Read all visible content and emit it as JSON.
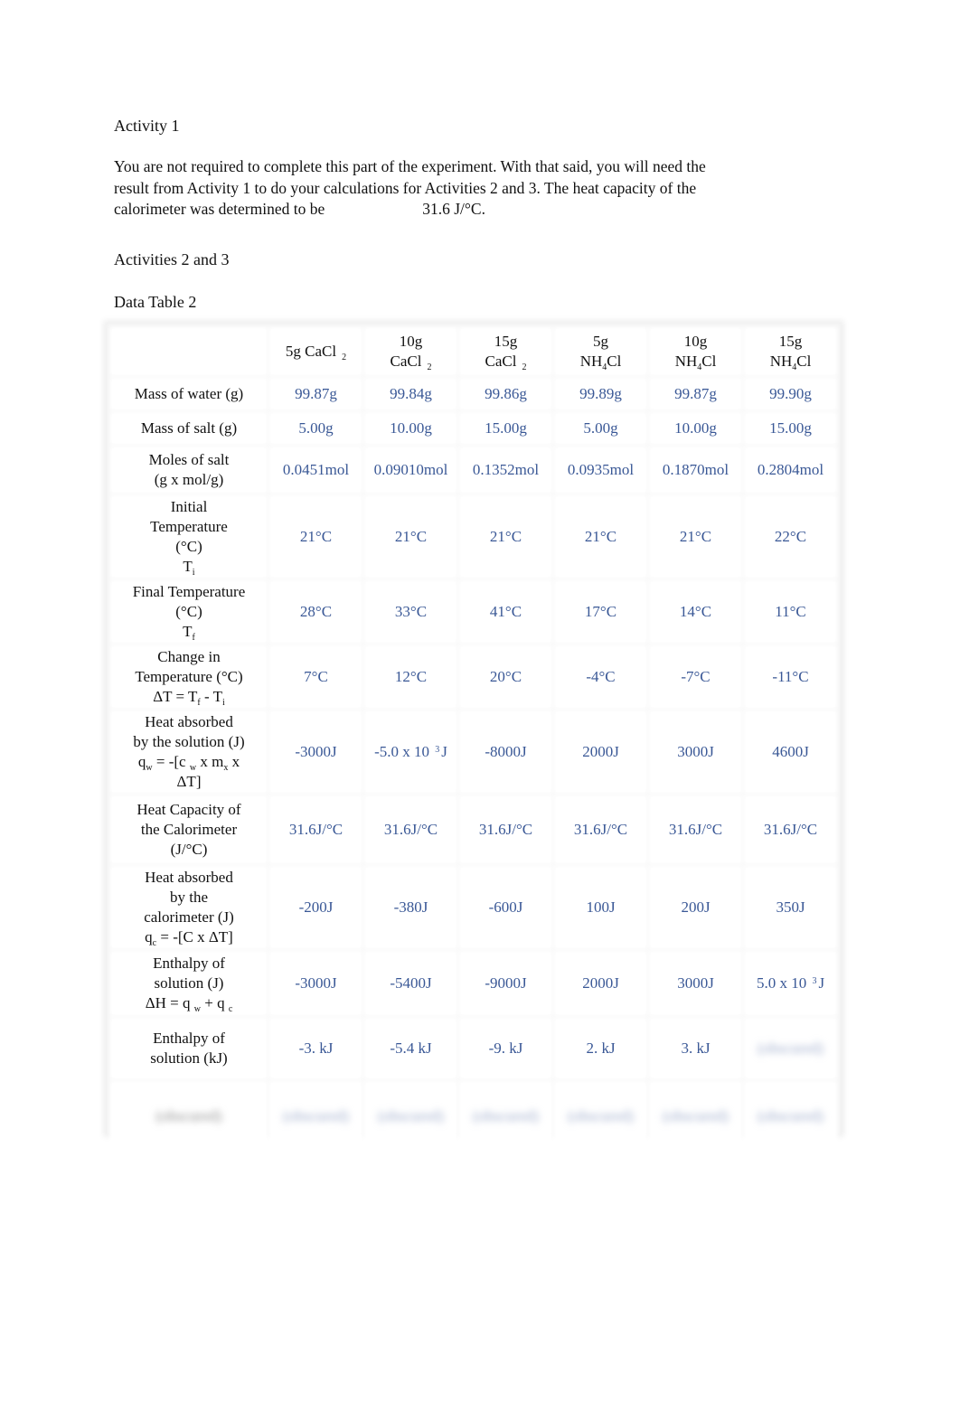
{
  "headings": {
    "activity1": "Activity 1",
    "activities23": "Activities 2 and 3",
    "data_table": "Data Table 2"
  },
  "intro": {
    "text": "You are not required to complete this part of the experiment. With that said, you will need the result from Activity 1 to do your calculations for Activities 2 and 3. The heat capacity of the calorimeter was determined to be",
    "value": "31.6 J/°C."
  },
  "table": {
    "columns": [
      {
        "amount": "5g",
        "formula": "CaCl",
        "sub": "2"
      },
      {
        "amount": "10g",
        "formula": "CaCl",
        "sub": "2"
      },
      {
        "amount": "15g",
        "formula": "CaCl",
        "sub": "2"
      },
      {
        "amount": "5g",
        "formula_pre": "NH",
        "sub": "4",
        "formula_post": "Cl"
      },
      {
        "amount": "10g",
        "formula_pre": "NH",
        "sub": "4",
        "formula_post": "Cl"
      },
      {
        "amount": "15g",
        "formula_pre": "NH",
        "sub": "4",
        "formula_post": "Cl"
      }
    ],
    "rows": {
      "mass_water": {
        "label": "Mass of water (g)",
        "values": [
          "99.87g",
          "99.84g",
          "99.86g",
          "99.89g",
          "99.87g",
          "99.90g"
        ]
      },
      "mass_salt": {
        "label": "Mass of salt (g)",
        "values": [
          "5.00g",
          "10.00g",
          "15.00g",
          "5.00g",
          "10.00g",
          "15.00g"
        ]
      },
      "moles_salt": {
        "label_1": "Moles of salt",
        "label_2": "(g x mol/g)",
        "values": [
          "0.0451mol",
          "0.09010mol",
          "0.1352mol",
          "0.0935mol",
          "0.1870mol",
          "0.2804mol"
        ]
      },
      "initial_temp": {
        "label_1": "Initial",
        "label_2": "Temperature",
        "label_3": "(°C)",
        "symbol": "T",
        "symbol_sub": "i",
        "values": [
          "21°C",
          "21°C",
          "21°C",
          "21°C",
          "21°C",
          "22°C"
        ]
      },
      "final_temp": {
        "label_1": "Final Temperature",
        "label_2": "(°C)",
        "symbol": "T",
        "symbol_sub": "f",
        "values": [
          "28°C",
          "33°C",
          "41°C",
          "17°C",
          "14°C",
          "11°C"
        ]
      },
      "change_temp": {
        "label_1": "Change in",
        "label_2": "Temperature (°C)",
        "formula": "ΔT = T",
        "f": "f",
        "minus": " - T",
        "i": "i",
        "values": [
          "7°C",
          "12°C",
          "20°C",
          "-4°C",
          "-7°C",
          "-11°C"
        ]
      },
      "heat_solution": {
        "label_1": "Heat absorbed",
        "label_2": "by the solution (J)",
        "f1": "q",
        "f1s": "w",
        "f2": " = -[c ",
        "f2s": "w",
        "f3": " x m",
        "f3s": "x",
        "f4": " x",
        "f5": "ΔT]",
        "values": [
          "-3000J",
          {
            "pre": "-5.0 x 10 ",
            "exp": "3",
            "post": "J"
          },
          "-8000J",
          "2000J",
          "3000J",
          "4600J"
        ]
      },
      "heat_capacity": {
        "label_1": "Heat Capacity of",
        "label_2": "the Calorimeter",
        "label_3": "(J/°C)",
        "values": [
          "31.6J/°C",
          "31.6J/°C",
          "31.6J/°C",
          "31.6J/°C",
          "31.6J/°C",
          "31.6J/°C"
        ]
      },
      "heat_calorimeter": {
        "label_1": "Heat absorbed",
        "label_2": "by the",
        "label_3": "calorimeter (J)",
        "f1": "q",
        "f1s": "c",
        "f2": " = -[C x  ΔT]",
        "values": [
          "-200J",
          "-380J",
          "-600J",
          "100J",
          "200J",
          "350J"
        ]
      },
      "enthalpy_j": {
        "label_1": "Enthalpy of",
        "label_2": "solution (J)",
        "f1": "ΔH = q ",
        "f1s": "w",
        "f2": " + q ",
        "f2s": "c",
        "values": [
          "-3000J",
          "-5400J",
          "-9000J",
          "2000J",
          "3000J",
          {
            "pre": "5.0 x 10 ",
            "exp": "3",
            "post": "J"
          }
        ]
      },
      "enthalpy_kj": {
        "label_1": "Enthalpy of",
        "label_2": "solution (kJ)",
        "values": [
          "-3. kJ",
          "-5.4 kJ",
          "-9. kJ",
          "2. kJ",
          "3. kJ",
          "(obscured)"
        ]
      },
      "obscured_row": {
        "label": "(obscured)",
        "values": [
          "(obscured)",
          "(obscured)",
          "(obscured)",
          "(obscured)",
          "(obscured)",
          "(obscured)"
        ]
      }
    }
  },
  "colors": {
    "value_text": "#3a5896",
    "label_text": "#111111",
    "grid": "#f3f3f3"
  }
}
